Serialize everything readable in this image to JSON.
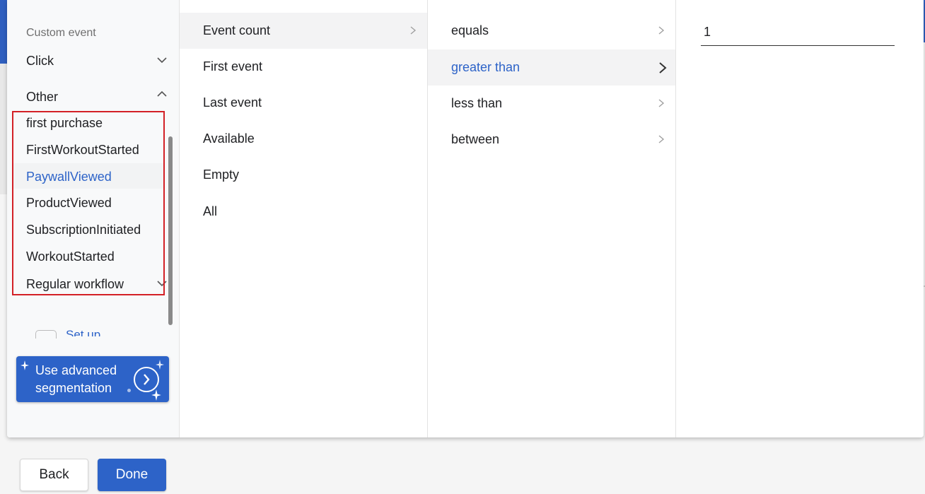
{
  "colors": {
    "accent": "#2d63c8",
    "highlight_border": "#d32026",
    "selected_bg": "#f3f3f4"
  },
  "sidebar": {
    "section_label": "Custom event",
    "click_group": {
      "label": "Click",
      "icon": "chevron-down-icon"
    },
    "other_group": {
      "label": "Other",
      "icon": "chevron-up-icon"
    },
    "events": [
      {
        "label": "first purchase",
        "selected": false
      },
      {
        "label": "FirstWorkoutStarted",
        "selected": false
      },
      {
        "label": "PaywallViewed",
        "selected": true
      },
      {
        "label": "ProductViewed",
        "selected": false
      },
      {
        "label": "SubscriptionInitiated",
        "selected": false
      },
      {
        "label": "WorkoutStarted",
        "selected": false
      }
    ],
    "regular_workflow": {
      "label": "Regular workflow",
      "icon": "chevron-down-icon"
    },
    "setup_link": "Set up",
    "advanced_button": {
      "label": "Use advanced segmentation",
      "icon": "chevron-right-circle-icon"
    }
  },
  "metric_options": [
    {
      "label": "Event count",
      "active": true,
      "has_arrow": true
    },
    {
      "label": "First event",
      "active": false,
      "has_arrow": false
    },
    {
      "label": "Last event",
      "active": false,
      "has_arrow": false
    },
    {
      "label": "Available",
      "active": false,
      "has_arrow": false
    },
    {
      "label": "Empty",
      "active": false,
      "has_arrow": false
    },
    {
      "label": "All",
      "active": false,
      "has_arrow": false
    }
  ],
  "operator_options": [
    {
      "label": "equals",
      "selected": false
    },
    {
      "label": "greater than",
      "selected": true
    },
    {
      "label": "less than",
      "selected": false
    },
    {
      "label": "between",
      "selected": false
    }
  ],
  "value_input": {
    "value": "1"
  },
  "footer": {
    "back_label": "Back",
    "done_label": "Done"
  }
}
